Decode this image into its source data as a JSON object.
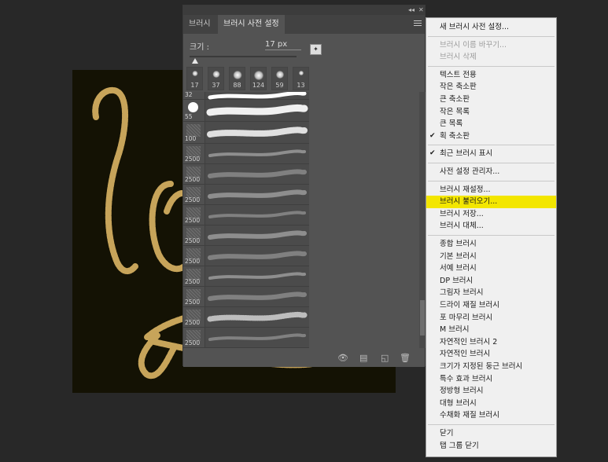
{
  "panel": {
    "window_controls": {
      "collapse": "◂◂",
      "close": "✕"
    },
    "tabs": [
      {
        "label": "브러시",
        "active": false
      },
      {
        "label": "브러시 사전 설정",
        "active": true
      }
    ],
    "size_label": "크기 :",
    "size_value": "17 px",
    "slider_fraction": 0.05,
    "thumbnails": [
      "17",
      "37",
      "88",
      "124",
      "59",
      "13"
    ],
    "rows": [
      {
        "num": "32"
      },
      {
        "num": "55"
      },
      {
        "num": "100"
      },
      {
        "num": "2500"
      },
      {
        "num": "2500"
      },
      {
        "num": "2500"
      },
      {
        "num": "2500"
      },
      {
        "num": "2500"
      },
      {
        "num": "2500"
      },
      {
        "num": "2500"
      },
      {
        "num": "2500"
      },
      {
        "num": "2500"
      },
      {
        "num": "2500"
      }
    ],
    "bottom_icons": [
      "eye-icon",
      "brush-panel-icon",
      "new-preset-icon",
      "trash-icon"
    ]
  },
  "menu": {
    "items": [
      {
        "label": "새 브러시 사전 설정...",
        "disabled": false
      },
      {
        "sep": true
      },
      {
        "label": "브러시 이름 바꾸기...",
        "disabled": true
      },
      {
        "label": "브러시 삭제",
        "disabled": true
      },
      {
        "sep": true
      },
      {
        "label": "텍스트 전용"
      },
      {
        "label": "작은 축소판"
      },
      {
        "label": "큰 축소판"
      },
      {
        "label": "작은 목록"
      },
      {
        "label": "큰 목록"
      },
      {
        "label": "획 축소판",
        "checked": true
      },
      {
        "sep": true
      },
      {
        "label": "최근 브러시 표시",
        "checked": true
      },
      {
        "sep": true
      },
      {
        "label": "사전 설정 관리자..."
      },
      {
        "sep": true
      },
      {
        "label": "브러시 재설정..."
      },
      {
        "label": "브러시 불러오기...",
        "highlighted": true
      },
      {
        "label": "브러시 저장..."
      },
      {
        "label": "브러시 대체..."
      },
      {
        "sep": true
      },
      {
        "label": "종합 브러시"
      },
      {
        "label": "기본 브러시"
      },
      {
        "label": "서예 브러시"
      },
      {
        "label": "DP 브러시"
      },
      {
        "label": "그림자 브러시"
      },
      {
        "label": "드라이 재질 브러시"
      },
      {
        "label": "포 마무리 브러시"
      },
      {
        "label": "M 브러시"
      },
      {
        "label": "자연적인 브러시 2"
      },
      {
        "label": "자연적인 브러시"
      },
      {
        "label": "크기가 지정된 둥근 브러시"
      },
      {
        "label": "특수 효과 브러시"
      },
      {
        "label": "정방형 브러시"
      },
      {
        "label": "대형 브러시"
      },
      {
        "label": "수채화 재질 브러시"
      },
      {
        "sep": true
      },
      {
        "label": "닫기"
      },
      {
        "label": "탭 그룹 닫기"
      }
    ]
  },
  "colors": {
    "rope": "#c7a45a",
    "canvas": "#141204",
    "highlight": "#f3e600"
  }
}
